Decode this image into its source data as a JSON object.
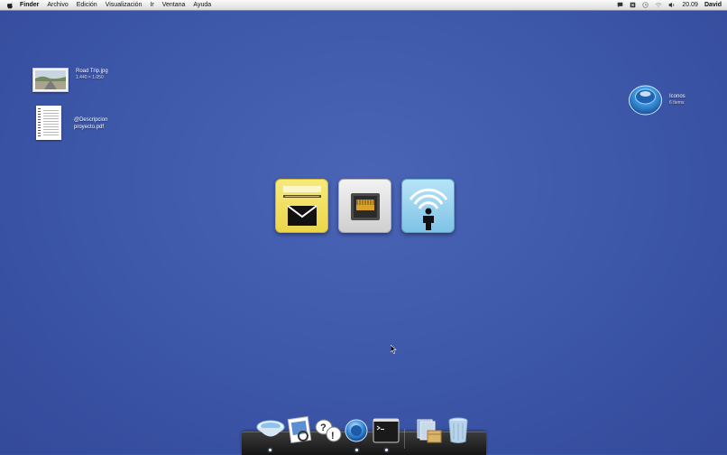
{
  "menubar": {
    "apple_icon": "apple-logo-icon",
    "menus": [
      "Finder",
      "Archivo",
      "Edición",
      "Visualización",
      "Ir",
      "Ventana",
      "Ayuda"
    ],
    "status_icons": [
      "chat-bubble-icon",
      "bluetooth-icon",
      "time-machine-icon",
      "wifi-icon",
      "volume-icon"
    ],
    "clock": "20.09",
    "user": "David"
  },
  "desktop": {
    "files": [
      {
        "name": "Road Trip.jpg",
        "info": "1.440 × 1.050",
        "icon": "image-file-icon"
      },
      {
        "name": "@Descripcion",
        "name_line2": "proyecto.pdf",
        "icon": "pdf-file-icon"
      }
    ],
    "disk": {
      "name": "Iconos",
      "info": "6 ítems",
      "icon": "disk-image-icon"
    }
  },
  "center_icons": [
    {
      "name": "mail",
      "icon": "mail-icon",
      "color": "#f1e062"
    },
    {
      "name": "ethernet",
      "icon": "ethernet-icon",
      "color": "#e0e0e0"
    },
    {
      "name": "wifi",
      "icon": "wifi-person-icon",
      "color": "#9ad3ee"
    }
  ],
  "dock": {
    "items": [
      {
        "name": "finder",
        "icon": "finder-bowl-icon",
        "running": true
      },
      {
        "name": "preview",
        "icon": "preview-icon",
        "running": false
      },
      {
        "name": "help",
        "icon": "help-bubbles-icon",
        "running": false
      },
      {
        "name": "system",
        "icon": "blue-orb-icon",
        "running": true
      },
      {
        "name": "terminal",
        "icon": "terminal-icon",
        "running": true
      },
      {
        "name": "documents",
        "icon": "documents-stack-icon",
        "running": false
      },
      {
        "name": "trash",
        "icon": "trash-icon",
        "running": false
      }
    ]
  },
  "colors": {
    "desktop": "#3c56a8",
    "menubar": "#e8e8e8",
    "dock": "#222222"
  }
}
